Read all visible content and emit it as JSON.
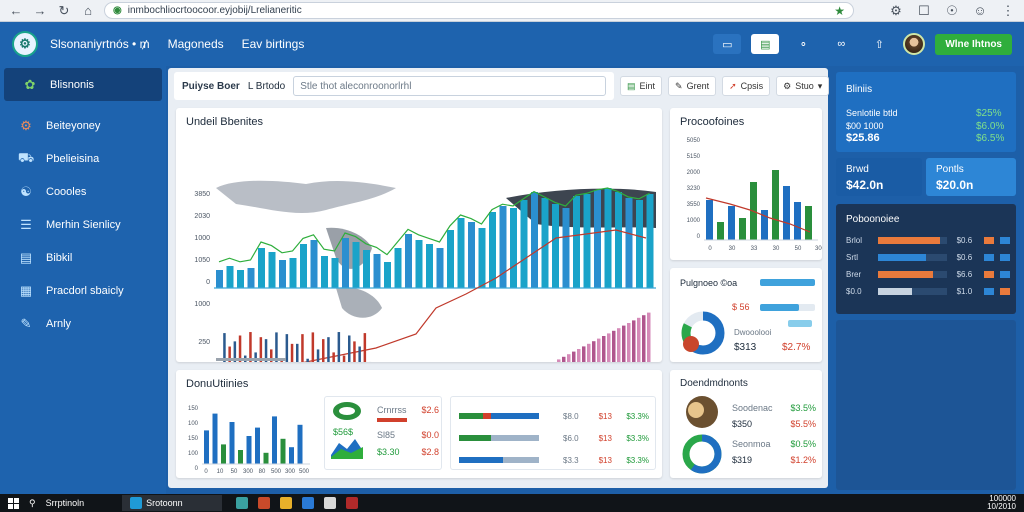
{
  "browser": {
    "url": "inmbochliocrtoocoor.eyjobij/Lrelianeritic",
    "icons": [
      "back-icon",
      "forward-icon",
      "reload-icon",
      "home-icon",
      "site-icon",
      "star-icon",
      "menu-icon"
    ]
  },
  "header": {
    "app_title": "Slsonaniyrtnós • ₥",
    "nav": [
      "Magoneds",
      "Eav birtings"
    ],
    "cta_label": "Wlne Ihtnos",
    "colors": {
      "bar": "#1e63ae",
      "cta": "#2fae3c"
    }
  },
  "sidebar": {
    "items": [
      {
        "label": "Blisnonis",
        "icon": "leaf-icon"
      },
      {
        "label": "Beiteyoney",
        "icon": "gear-icon"
      },
      {
        "label": "Pbelieisina",
        "icon": "truck-icon"
      },
      {
        "label": "Coooles",
        "icon": "globe-icon"
      },
      {
        "label": "Merhin Sienlicy",
        "icon": "book-icon"
      },
      {
        "label": "Bibkil",
        "icon": "document-icon"
      },
      {
        "label": "Pracdorl sbaicly",
        "icon": "chart-icon"
      },
      {
        "label": "Arnly",
        "icon": "pen-icon"
      }
    ]
  },
  "toolbar": {
    "filter_label": "Puiyse Boer",
    "scope_label": "L Brtodo",
    "search_value": "Stle thot aleconroonorlrhl",
    "actions": [
      "Eint",
      "Grent",
      "Cpsis",
      "Stuo"
    ]
  },
  "main_chart": {
    "title": "Undeil Bbenites",
    "y_ticks_top": [
      "3850",
      "2030",
      "1000",
      "1050",
      "0"
    ],
    "y_ticks_bottom": [
      "1000",
      "250",
      "0"
    ],
    "x_ticks": [
      "0",
      "310",
      "300",
      "130",
      "340",
      "300",
      "320",
      "305",
      "330",
      "520",
      "360",
      "300"
    ]
  },
  "proc_chart": {
    "title": "Procoofoines",
    "y_ticks": [
      "5050",
      "5150",
      "2000",
      "3230",
      "3550",
      "1000",
      "0"
    ],
    "x_ticks": [
      "0",
      "30",
      "33",
      "30",
      "50",
      "300"
    ]
  },
  "progress_card": {
    "title": "Pulgnoeo ©oa",
    "rows": [
      {
        "label": "$ 56",
        "fill": 0.7
      },
      {
        "label": "Dwooolooi",
        "fill": 0.4
      }
    ],
    "value_1": "$313",
    "value_2": "$2.7%"
  },
  "bottom_left": {
    "title": "DonuUtiinies",
    "y_ticks": [
      "150",
      "100",
      "150",
      "100",
      "0"
    ],
    "x_ticks": [
      "0",
      "10",
      "50",
      "300",
      "80",
      "500",
      "300",
      "500"
    ]
  },
  "bottom_table_a": {
    "badge_value": "$56$",
    "rows": [
      {
        "name": "Crnrrss",
        "val": "$2.6"
      },
      {
        "name": "Sl85",
        "val": "$0.0"
      },
      {
        "name": "$3.30",
        "val": "$2.8"
      }
    ]
  },
  "bottom_table_b": {
    "rows": [
      {
        "col1": "$8.0",
        "col2": "$13",
        "col3": "$3.3%"
      },
      {
        "col1": "$6.0",
        "col2": "$13",
        "col3": "$3.3%"
      },
      {
        "col1": "$3.3",
        "col2": "$13",
        "col3": "$3.3%"
      }
    ]
  },
  "donut_card": {
    "title": "Doendmdnonts",
    "rows": [
      {
        "name": "Soodenac",
        "val": "$3.5%",
        "color": "#1f9a3a"
      },
      {
        "name": "$350",
        "val": "$5.5%",
        "color": "#d1402c"
      },
      {
        "name": "Seonmoa",
        "val": "$0.5%",
        "color": "#1f9a3a"
      },
      {
        "name": "$319",
        "val": "$1.2%",
        "color": "#d1402c"
      }
    ]
  },
  "right_panel": {
    "blue_title": "Bliniis",
    "blue_rows": [
      {
        "label": "Senlotile btld",
        "value": "$25%"
      },
      {
        "label": "$00 1000",
        "value": "$6.0%"
      },
      {
        "label": "$25.86",
        "value": "$6.5%"
      }
    ],
    "stat_a_label": "Brwd",
    "stat_a_value": "$42.0n",
    "stat_b_label": "Pontls",
    "stat_b_value": "$20.0n",
    "dark_title": "Poboonoiee",
    "dark_rows": [
      {
        "label": "Brlol",
        "v1": "$0.6",
        "fill": 0.9
      },
      {
        "label": "Srtl",
        "v1": "$0.6",
        "fill": 0.7
      },
      {
        "label": "Brer",
        "v1": "$6.6",
        "fill": 0.8
      },
      {
        "label": "$0.0",
        "v1": "$1.0",
        "fill": 0.5
      }
    ]
  },
  "taskbar": {
    "search_label": "Srrptinoln",
    "app_label": "Srotoonn",
    "time": "100000",
    "date": "10/2010"
  }
}
